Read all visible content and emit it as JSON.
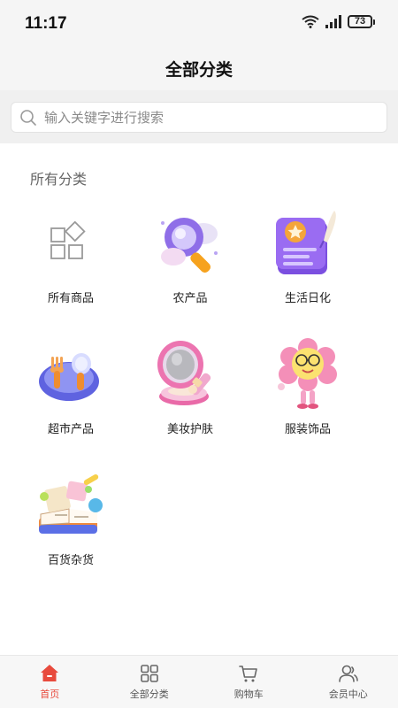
{
  "status": {
    "time": "11:17",
    "battery": "73"
  },
  "header": {
    "title": "全部分类"
  },
  "search": {
    "placeholder": "输入关键字进行搜索"
  },
  "section": {
    "title": "所有分类"
  },
  "categories": [
    {
      "label": "所有商品",
      "icon": "grid-shapes-icon"
    },
    {
      "label": "农产品",
      "icon": "magnifier-3d-icon"
    },
    {
      "label": "生活日化",
      "icon": "certificate-3d-icon"
    },
    {
      "label": "超市产品",
      "icon": "fork-spoon-plate-icon"
    },
    {
      "label": "美妆护肤",
      "icon": "compact-powder-icon"
    },
    {
      "label": "服装饰品",
      "icon": "flower-glasses-icon"
    },
    {
      "label": "百货杂货",
      "icon": "book-stationery-icon"
    }
  ],
  "tabbar": {
    "tabs": [
      {
        "label": "首页",
        "icon": "home-icon",
        "active": true
      },
      {
        "label": "全部分类",
        "icon": "grid-icon",
        "active": false
      },
      {
        "label": "购物车",
        "icon": "cart-icon",
        "active": false
      },
      {
        "label": "会员中心",
        "icon": "user-icon",
        "active": false
      }
    ],
    "active_color": "#e84a3d"
  }
}
